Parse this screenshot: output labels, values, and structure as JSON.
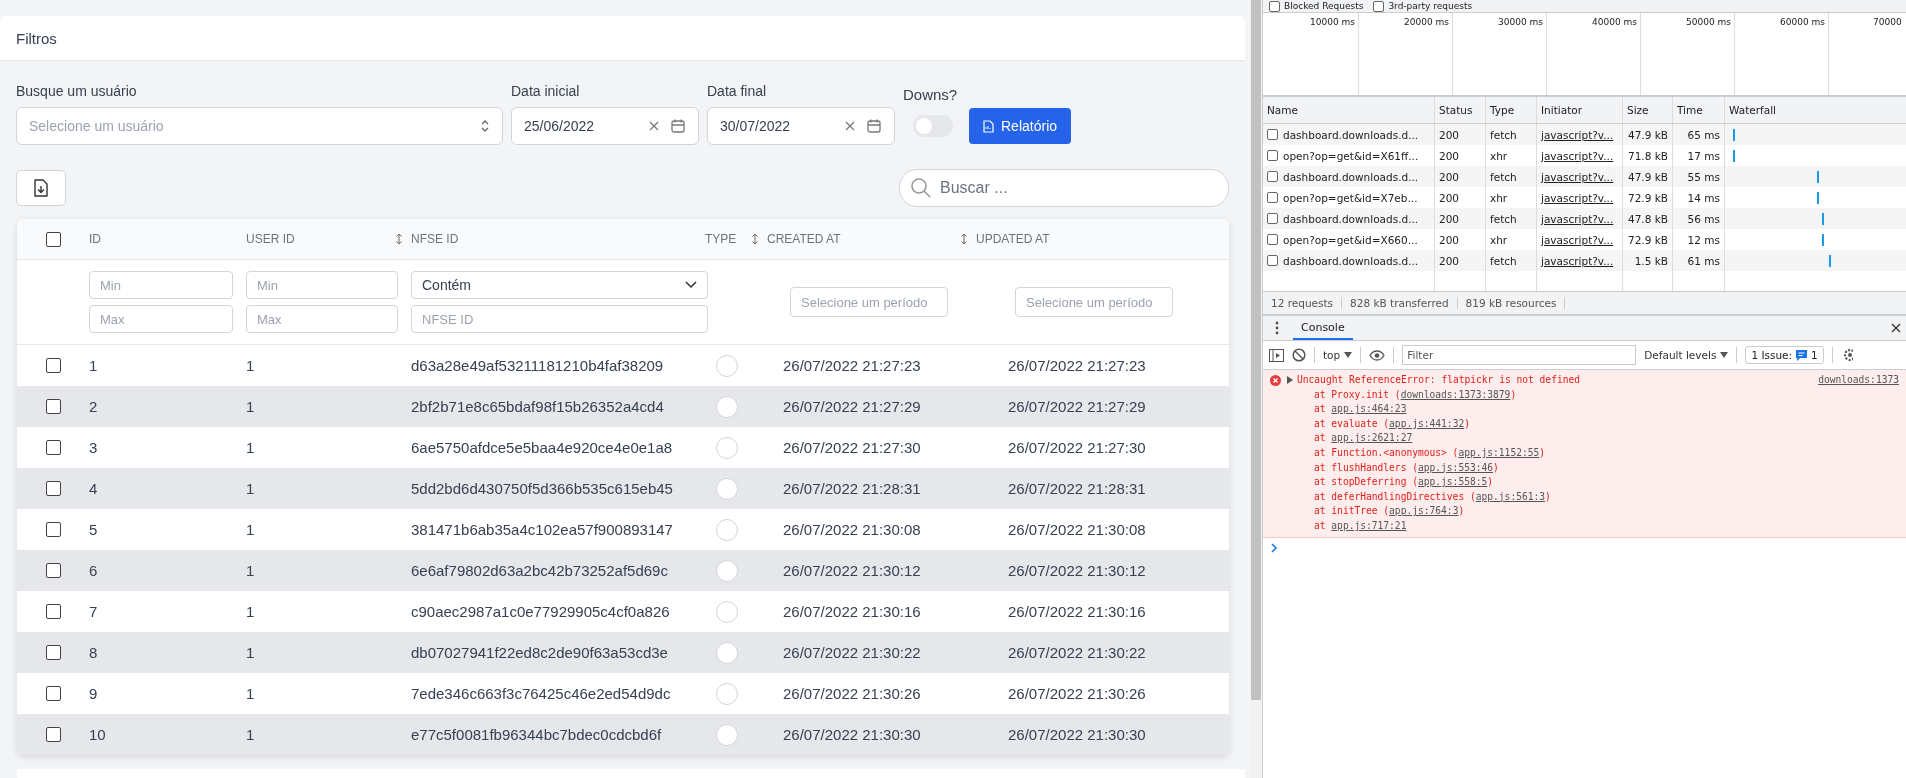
{
  "filters": {
    "title": "Filtros",
    "user": {
      "label": "Busque um usuário",
      "placeholder": "Selecione um usuário"
    },
    "start": {
      "label": "Data inicial",
      "value": "25/06/2022"
    },
    "end": {
      "label": "Data final",
      "value": "30/07/2022"
    },
    "downs": {
      "label": "Downs?",
      "on": false
    },
    "report_button": "Relatório"
  },
  "search": {
    "placeholder": "Buscar ..."
  },
  "table": {
    "select_all_checked": false,
    "columns": [
      {
        "label": "ID",
        "sortable": false
      },
      {
        "label": "USER ID",
        "sortable": false
      },
      {
        "label": "NFSE ID",
        "sortable": true
      },
      {
        "label": "TYPE",
        "sortable": false
      },
      {
        "label": "CREATED AT",
        "sortable": true
      },
      {
        "label": "UPDATED AT",
        "sortable": true
      }
    ],
    "filters": {
      "id_min": "Min",
      "id_max": "Max",
      "user_min": "Min",
      "user_max": "Max",
      "nfse_mode": "Contém",
      "nfse_placeholder": "NFSE ID",
      "created_placeholder": "Selecione um período",
      "updated_placeholder": "Selecione um período"
    },
    "rows": [
      {
        "checked": false,
        "id": "1",
        "user_id": "1",
        "nfse_id": "d63a28e49af53211181210b4faf38209",
        "created": "26/07/2022 21:27:23",
        "updated": "26/07/2022 21:27:23"
      },
      {
        "checked": false,
        "id": "2",
        "user_id": "1",
        "nfse_id": "2bf2b71e8c65bdaf98f15b26352a4cd4",
        "created": "26/07/2022 21:27:29",
        "updated": "26/07/2022 21:27:29"
      },
      {
        "checked": false,
        "id": "3",
        "user_id": "1",
        "nfse_id": "6ae5750afdce5e5baa4e920ce4e0e1a8",
        "created": "26/07/2022 21:27:30",
        "updated": "26/07/2022 21:27:30"
      },
      {
        "checked": false,
        "id": "4",
        "user_id": "1",
        "nfse_id": "5dd2bd6d430750f5d366b535c615eb45",
        "created": "26/07/2022 21:28:31",
        "updated": "26/07/2022 21:28:31"
      },
      {
        "checked": false,
        "id": "5",
        "user_id": "1",
        "nfse_id": "381471b6ab35a4c102ea57f900893147",
        "created": "26/07/2022 21:30:08",
        "updated": "26/07/2022 21:30:08"
      },
      {
        "checked": false,
        "id": "6",
        "user_id": "1",
        "nfse_id": "6e6af79802d63a2bc42b73252af5d69c",
        "created": "26/07/2022 21:30:12",
        "updated": "26/07/2022 21:30:12"
      },
      {
        "checked": false,
        "id": "7",
        "user_id": "1",
        "nfse_id": "c90aec2987a1c0e77929905c4cf0a826",
        "created": "26/07/2022 21:30:16",
        "updated": "26/07/2022 21:30:16"
      },
      {
        "checked": false,
        "id": "8",
        "user_id": "1",
        "nfse_id": "db07027941f22ed8c2de90f63a53cd3e",
        "created": "26/07/2022 21:30:22",
        "updated": "26/07/2022 21:30:22"
      },
      {
        "checked": false,
        "id": "9",
        "user_id": "1",
        "nfse_id": "7ede346c663f3c76425c46e2ed54d9dc",
        "created": "26/07/2022 21:30:26",
        "updated": "26/07/2022 21:30:26"
      },
      {
        "checked": false,
        "id": "10",
        "user_id": "1",
        "nfse_id": "e77c5f0081fb96344bc7bdec0cdcbd6f",
        "created": "26/07/2022 21:30:30",
        "updated": "26/07/2022 21:30:30"
      }
    ]
  },
  "devtools": {
    "options": [
      {
        "label": "Blocked Requests",
        "checked": false
      },
      {
        "label": "3rd-party requests",
        "checked": false
      }
    ],
    "timeline_ticks": [
      "10000 ms",
      "20000 ms",
      "30000 ms",
      "40000 ms",
      "50000 ms",
      "60000 ms",
      "70000"
    ],
    "network_columns": [
      "Name",
      "Status",
      "Type",
      "Initiator",
      "Size",
      "Time",
      "Waterfall"
    ],
    "requests": [
      {
        "name": "dashboard.downloads.d...",
        "status": "200",
        "type": "fetch",
        "initiator": "javascript?v...",
        "size": "47.9 kB",
        "time": "65 ms"
      },
      {
        "name": "open?op=get&id=X61ff...",
        "status": "200",
        "type": "xhr",
        "initiator": "javascript?v...",
        "size": "71.8 kB",
        "time": "17 ms"
      },
      {
        "name": "dashboard.downloads.d...",
        "status": "200",
        "type": "fetch",
        "initiator": "javascript?v...",
        "size": "47.9 kB",
        "time": "55 ms"
      },
      {
        "name": "open?op=get&id=X7eb...",
        "status": "200",
        "type": "xhr",
        "initiator": "javascript?v...",
        "size": "72.9 kB",
        "time": "14 ms"
      },
      {
        "name": "dashboard.downloads.d...",
        "status": "200",
        "type": "fetch",
        "initiator": "javascript?v...",
        "size": "47.8 kB",
        "time": "56 ms"
      },
      {
        "name": "open?op=get&id=X660...",
        "status": "200",
        "type": "xhr",
        "initiator": "javascript?v...",
        "size": "72.9 kB",
        "time": "12 ms"
      },
      {
        "name": "dashboard.downloads.d...",
        "status": "200",
        "type": "fetch",
        "initiator": "javascript?v...",
        "size": "1.5 kB",
        "time": "61 ms"
      }
    ],
    "summary": [
      "12 requests",
      "828 kB transferred",
      "819 kB resources"
    ],
    "console_tab": "Console",
    "context": "top",
    "filter_placeholder": "Filter",
    "levels": "Default levels",
    "issues_label": "1 Issue:",
    "issues_count": "1",
    "error": {
      "message": "Uncaught ReferenceError: flatpickr is not defined",
      "source": "downloads:1373",
      "frames": [
        {
          "before": "at Proxy.init (",
          "link": "downloads:1373:3879",
          "after": ")"
        },
        {
          "before": "at ",
          "link": "app.js:464:23"
        },
        {
          "before": "at evaluate (",
          "link": "app.js:441:32",
          "after": ")"
        },
        {
          "before": "at ",
          "link": "app.js:2621:27"
        },
        {
          "before": "at Function.<anonymous> (",
          "link": "app.js:1152:55",
          "after": ")"
        },
        {
          "before": "at flushHandlers (",
          "link": "app.js:553:46",
          "after": ")"
        },
        {
          "before": "at stopDeferring (",
          "link": "app.js:558:5",
          "after": ")"
        },
        {
          "before": "at deferHandlingDirectives (",
          "link": "app.js:561:3",
          "after": ")"
        },
        {
          "before": "at initTree (",
          "link": "app.js:764:3",
          "after": ")"
        },
        {
          "before": "at ",
          "link": "app.js:717:21"
        }
      ]
    }
  }
}
